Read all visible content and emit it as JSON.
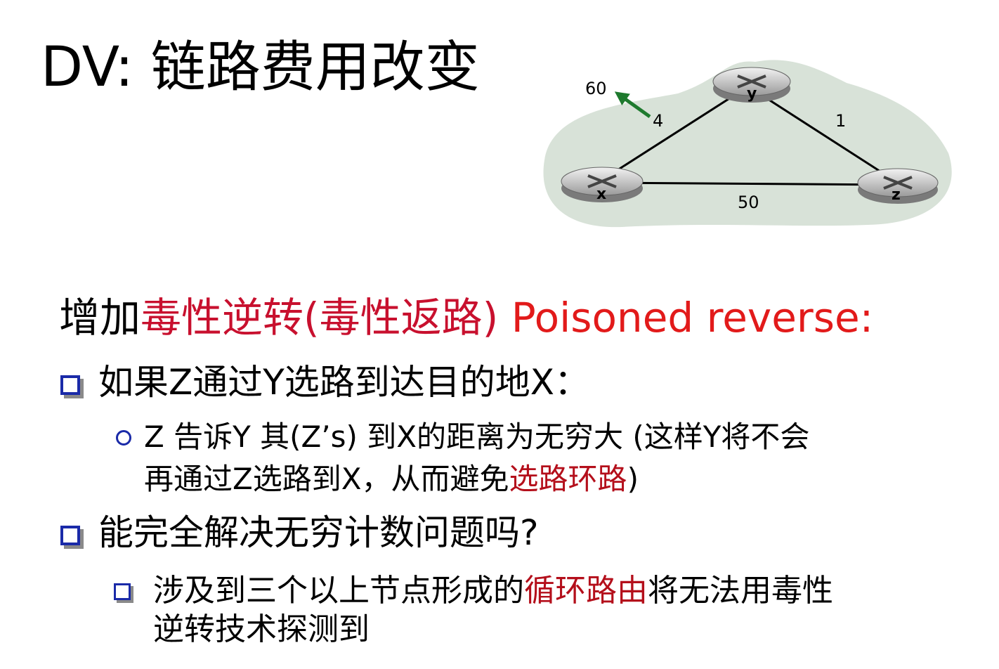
{
  "title": "DV: 链路费用改变",
  "diagram": {
    "nodes": {
      "x": "x",
      "y": "y",
      "z": "z"
    },
    "edge_xy_cost": "4",
    "edge_xy_new_cost": "60",
    "edge_yz_cost": "1",
    "edge_xz_cost": "50"
  },
  "heading": {
    "prefix": "增加",
    "red_cn": "毒性逆转(毒性返路)",
    "red_en": "Poisoned reverse:"
  },
  "bullet1": "如果Z通过Y选路到达目的地X：",
  "sub1_line1": "Z 告诉Y 其(Z’s) 到X的距离为无穷大 (这样Y将不会",
  "sub1_line2_a": "再通过Z选路到X，从而避免",
  "sub1_line2_red": "选路环路",
  "sub1_line2_b": ")",
  "bullet2": "能完全解决无穷计数问题吗?",
  "sub2_line1_a": "涉及到三个以上节点形成的",
  "sub2_line1_red": "循环路由",
  "sub2_line1_b": "将无法用毒性",
  "sub2_line2": "逆转技术探测到"
}
